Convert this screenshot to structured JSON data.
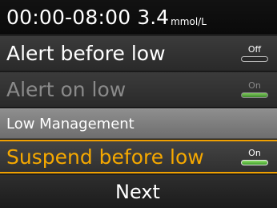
{
  "header": {
    "time_range": "00:00-08:00",
    "glucose_value": "3.4",
    "unit": "mmol/L"
  },
  "settings": [
    {
      "label": "Alert before low",
      "toggle_text": "Off",
      "toggle_state": "off",
      "enabled": true
    },
    {
      "label": "Alert on low",
      "toggle_text": "On",
      "toggle_state": "on",
      "enabled": false
    }
  ],
  "section_header": "Low Management",
  "selected_setting": {
    "label": "Suspend before low",
    "toggle_text": "On",
    "toggle_state": "on"
  },
  "next_button": "Next",
  "colors": {
    "selection_highlight": "#f0a000",
    "toggle_on": "#4fb52f",
    "section_band": "#7e7e7e"
  }
}
